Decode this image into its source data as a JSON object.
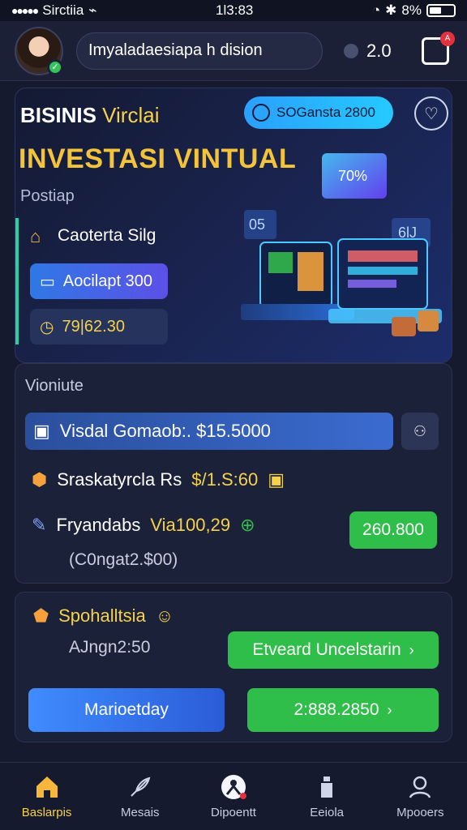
{
  "status_bar": {
    "carrier": "Sirctiia",
    "time": "1l3:83",
    "battery": "8%"
  },
  "header": {
    "search_text": "Imyaladaesiapa h dision",
    "coins": "2.0"
  },
  "hero": {
    "brand": "BISINIS",
    "brand_accent": "Virclai",
    "chip": "SOGansta 2800",
    "headline": "INVESTASI VINTUAL",
    "subheading": "Postiap",
    "item1": "Caoterta Silg",
    "pill_blue": "Aocilapt 300",
    "pill_dark": "79|62.30",
    "art_labels": [
      "70%",
      "05",
      "6lJ"
    ]
  },
  "card1": {
    "label": "Vioniute",
    "info_bar": "Visdal Gomaob:. $15.5000",
    "row1_text": "Sraskatyrcla Rs",
    "row1_value": "$/1.S:60",
    "row2_text": "Fryandabs",
    "row2_value": "Via100,29",
    "green_button": "260.800",
    "note": "(C0ngat2.$00)"
  },
  "card2": {
    "title": "Spohalltsia",
    "sub": "AJngn2:50",
    "btn_primary": "Etveard Uncelstarin",
    "btn_blue": "Marioetday",
    "btn_amount": "2:888.2850"
  },
  "nav": {
    "items": [
      {
        "label": "Baslarpis",
        "icon": "home-icon"
      },
      {
        "label": "Mesais",
        "icon": "feather-icon"
      },
      {
        "label": "Dipoentt",
        "icon": "person-icon"
      },
      {
        "label": "Eeiola",
        "icon": "bottle-icon"
      },
      {
        "label": "Mpooers",
        "icon": "user-icon"
      }
    ]
  }
}
